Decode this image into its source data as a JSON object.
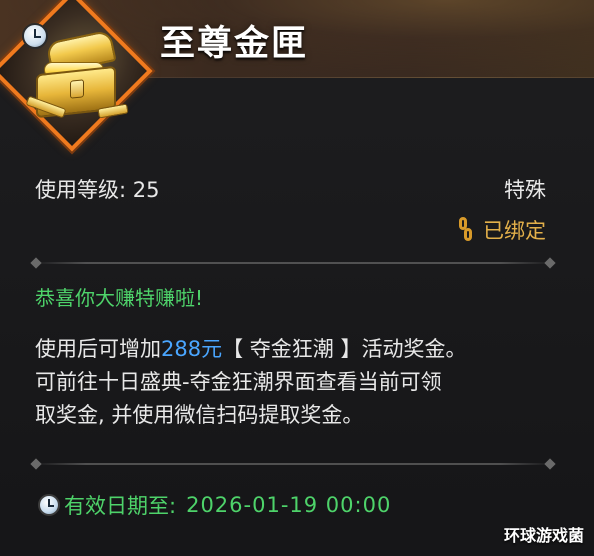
{
  "item": {
    "name": "至尊金匣",
    "icon": "treasure-chest-icon",
    "badge_icon": "clock-icon",
    "frame_color": "#f07a1e"
  },
  "stats": {
    "level_label": "使用等级: 25",
    "type_label": "特殊",
    "bound_icon": "link-icon",
    "bound_label": "已绑定"
  },
  "description": {
    "congrats": "恭喜你大赚特赚啦!",
    "line1_prefix": "使用后可增加",
    "line1_amount": "288元",
    "line1_suffix": "【 夺金狂潮 】活动奖金。",
    "line2": "可前往十日盛典-夺金狂潮界面查看当前可领",
    "line3": "取奖金, 并使用微信扫码提取奖金。"
  },
  "expiry": {
    "icon": "clock-icon",
    "label": "有效日期至:",
    "value": "2026-01-19  00:00"
  },
  "watermark": "环球游戏菌",
  "colors": {
    "green": "#4ed36a",
    "blue": "#4aa6ff",
    "gold": "#e3b04a"
  }
}
